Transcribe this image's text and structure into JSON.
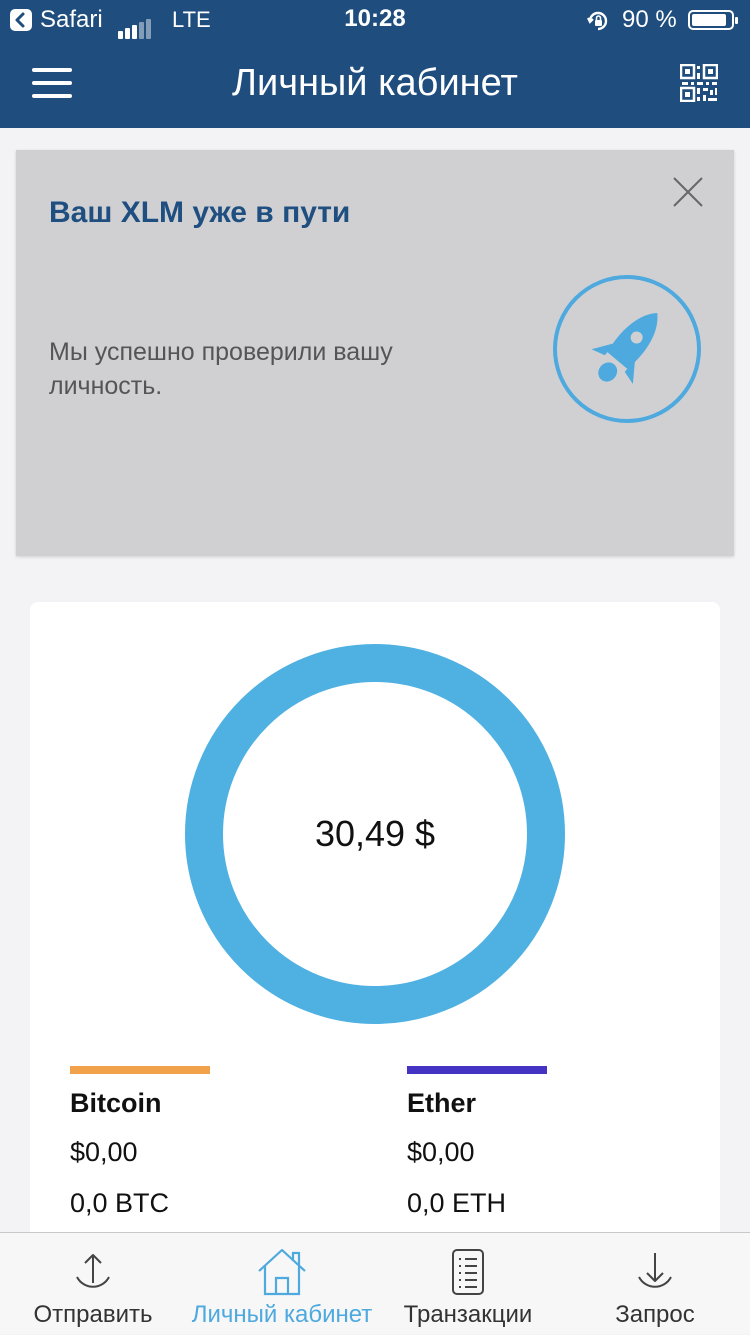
{
  "status_bar": {
    "app": "Safari",
    "network": "LTE",
    "time": "10:28",
    "battery": "90 %",
    "battery_level": 0.9
  },
  "header": {
    "title": "Личный кабинет",
    "menu_icon": "hamburger-menu-icon",
    "qr_icon": "qr-code-icon"
  },
  "banner": {
    "title": "Ваш XLM уже в пути",
    "text": "Мы успешно проверили вашу личность.",
    "icon": "rocket-icon",
    "close_icon": "close-icon"
  },
  "portfolio": {
    "total": "30,49 $",
    "ring_color": "#4fb0e2",
    "assets": [
      {
        "name": "Bitcoin",
        "usd": "$0,00",
        "amount": "0,0 BTC",
        "color": "#f2a24a"
      },
      {
        "name": "Ether",
        "usd": "$0,00",
        "amount": "0,0 ETH",
        "color": "#4534c4"
      }
    ]
  },
  "tabs": [
    {
      "label": "Отправить",
      "icon": "send-icon",
      "active": false
    },
    {
      "label": "Личный кабинет",
      "icon": "home-icon",
      "active": true
    },
    {
      "label": "Транзакции",
      "icon": "transactions-icon",
      "active": false
    },
    {
      "label": "Запрос",
      "icon": "request-icon",
      "active": false
    }
  ],
  "colors": {
    "header_bg": "#1e4d7e",
    "accent": "#4ea9de",
    "banner_bg": "#d0d0d3"
  }
}
